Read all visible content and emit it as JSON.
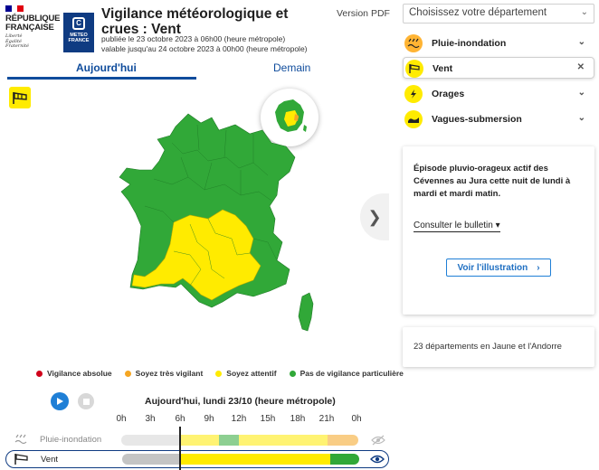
{
  "header": {
    "republique": "RÉPUBLIQUE FRANÇAISE",
    "motto": [
      "Liberté",
      "Égalité",
      "Fraternité"
    ],
    "meteo_logo": "METEO FRANCE",
    "title": "Vigilance météorologique et crues : Vent",
    "published": "publiée le 23 octobre 2023 à 06h00 (heure métropole)",
    "valid_until": "valable jusqu'au 24 octobre 2023 à 00h00 (heure métropole)",
    "pdf_label": "Version PDF"
  },
  "tabs": {
    "today": "Aujourd'hui",
    "tomorrow": "Demain"
  },
  "legend": [
    {
      "label": "Vigilance absolue",
      "color": "#d0021b"
    },
    {
      "label": "Soyez très vigilant",
      "color": "#f5a623"
    },
    {
      "label": "Soyez attentif",
      "color": "#ffeb00"
    },
    {
      "label": "Pas de vigilance particulière",
      "color": "#31a838"
    }
  ],
  "player": {
    "date_label": "Aujourd'hui, lundi 23/10 (heure métropole)",
    "hours": [
      "0h",
      "3h",
      "6h",
      "9h",
      "12h",
      "15h",
      "18h",
      "21h",
      "0h"
    ]
  },
  "timeline": {
    "pluie_label": "Pluie-inondation",
    "vent_label": "Vent"
  },
  "sidebar": {
    "department_placeholder": "Choisissez votre département",
    "phenomena": [
      {
        "label": "Pluie-inondation",
        "icon": "rain-flood-icon",
        "color": "#ffb433"
      },
      {
        "label": "Vent",
        "icon": "windsock-icon",
        "color": "#ffeb00"
      },
      {
        "label": "Orages",
        "icon": "lightning-icon",
        "color": "#ffeb00"
      },
      {
        "label": "Vagues-submersion",
        "icon": "waves-icon",
        "color": "#ffeb00"
      }
    ],
    "info_text": "Épisode pluvio-orageux actif des Cévennes au Jura cette nuit de lundi à mardi et mardi matin.",
    "bulletin_link": "Consulter le bulletin",
    "illustration_button": "Voir l'illustration",
    "summary": "23 départements en Jaune et l'Andorre"
  },
  "colors": {
    "green": "#31a838",
    "yellow": "#ffeb00",
    "blue": "#0f4c9c"
  }
}
